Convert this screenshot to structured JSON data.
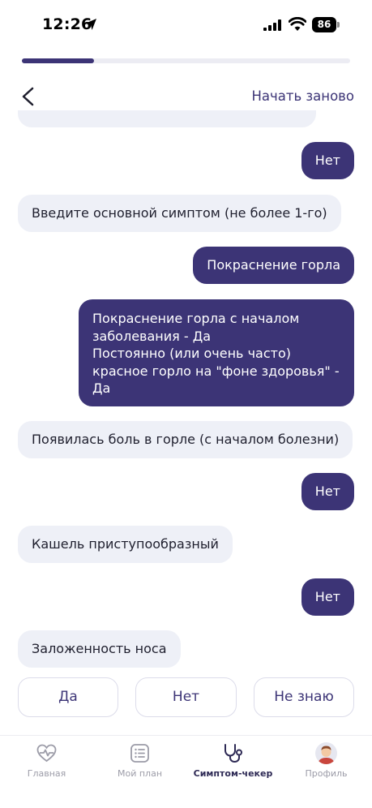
{
  "status_bar": {
    "time": "12:26",
    "battery": "86"
  },
  "progress": {
    "fraction": 0.22
  },
  "header": {
    "restart_label": "Начать заново"
  },
  "messages": [
    {
      "from": "user",
      "text": "Нет"
    },
    {
      "from": "bot",
      "text": "Введите основной симптом (не более 1-го)"
    },
    {
      "from": "user",
      "text": "Покраснение горла"
    },
    {
      "from": "user",
      "text": "Покраснение горла с началом\nзаболевания - Да\nПостоянно (или очень часто)\nкрасное горло на \"фоне здоровья\" -\nДа"
    },
    {
      "from": "bot",
      "text": "Появилась боль в горле (с началом болезни)"
    },
    {
      "from": "user",
      "text": "Нет"
    },
    {
      "from": "bot",
      "text": "Кашель приступообразный"
    },
    {
      "from": "user",
      "text": "Нет"
    },
    {
      "from": "bot",
      "text": "Заложенность носа"
    }
  ],
  "answers": {
    "yes": "Да",
    "no": "Нет",
    "dont_know": "Не знаю"
  },
  "tabs": [
    {
      "label": "Главная",
      "icon": "heart-pulse-icon"
    },
    {
      "label": "Мой план",
      "icon": "list-icon"
    },
    {
      "label": "Симптом-чекер",
      "icon": "stethoscope-icon",
      "active": true
    },
    {
      "label": "Профиль",
      "icon": "avatar-icon"
    }
  ],
  "colors": {
    "accent": "#3c3476",
    "bot_bubble": "#eef0f7",
    "inactive": "#9c9ca8"
  }
}
